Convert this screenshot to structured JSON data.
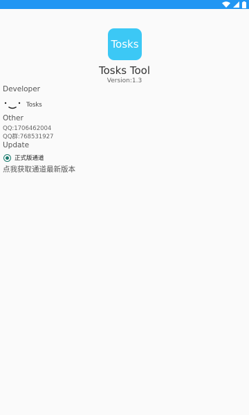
{
  "status_bar": {
    "icons": [
      "wifi-icon",
      "signal-icon",
      "battery-icon"
    ]
  },
  "app": {
    "icon_text": "Tosks",
    "name": "Tosks Tool",
    "version": "Version:1.3"
  },
  "developer": {
    "title": "Developer",
    "name": "Tosks"
  },
  "other": {
    "title": "Other",
    "qq": "QQ:1706462004",
    "qq_group": "QQ群:768531927"
  },
  "update": {
    "title": "Update",
    "channel_label": "正式版通道",
    "channel_selected": true,
    "hint": "点我获取通道最新版本"
  },
  "colors": {
    "status_bar": "#2196f3",
    "app_icon": "#3cc8f5",
    "radio_accent": "#1a7a6d",
    "background": "#fafafa"
  }
}
